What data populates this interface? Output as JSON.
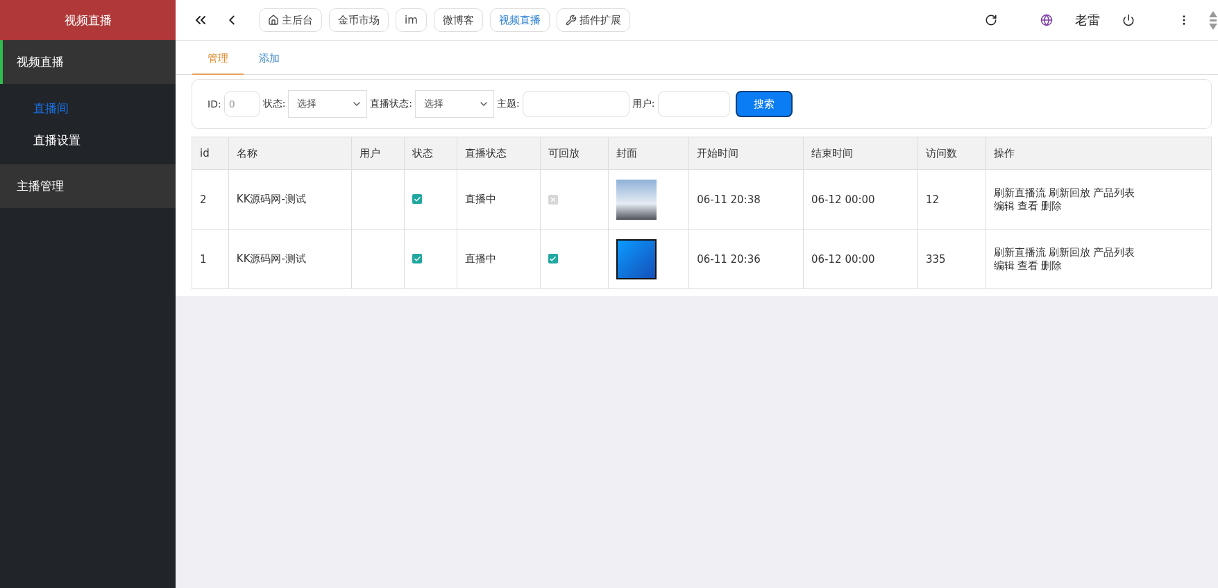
{
  "sidebar": {
    "brand": "视频直播",
    "groups": [
      {
        "label": "视频直播",
        "expanded": true,
        "children": [
          {
            "label": "直播间",
            "selected": true
          },
          {
            "label": "直播设置",
            "selected": false
          }
        ]
      },
      {
        "label": "主播管理",
        "expanded": false
      }
    ]
  },
  "topbar": {
    "nav_tabs": [
      {
        "label": "主后台",
        "kind": "home",
        "selected": false
      },
      {
        "label": "金币市场",
        "kind": "plain",
        "selected": false
      },
      {
        "label": "im",
        "kind": "plain",
        "selected": false
      },
      {
        "label": "微博客",
        "kind": "plain",
        "selected": false
      },
      {
        "label": "视频直播",
        "kind": "plain",
        "selected": true
      },
      {
        "label": "插件扩展",
        "kind": "plugin",
        "selected": false
      }
    ],
    "user": "老雷"
  },
  "page_tabs": [
    {
      "label": "管理",
      "selected": true
    },
    {
      "label": "添加",
      "selected": false
    }
  ],
  "filters": [
    {
      "kind": "input",
      "label": "ID:",
      "placeholder": "0"
    },
    {
      "kind": "select",
      "label": "状态:",
      "value": "选择"
    },
    {
      "kind": "select",
      "label": "直播状态:",
      "value": "选择"
    },
    {
      "kind": "input",
      "label": "主题:"
    },
    {
      "kind": "input",
      "label": "用户:"
    }
  ],
  "search_button": "搜索",
  "table": {
    "columns": [
      "id",
      "名称",
      "用户",
      "状态",
      "直播状态",
      "可回放",
      "封面",
      "开始时间",
      "结束时间",
      "访问数",
      "操作"
    ],
    "rows": [
      {
        "id": "2",
        "name": "KK源码网-测试",
        "status": true,
        "live_status": "直播中",
        "replayable": false,
        "cover": {
          "kind": "photo"
        },
        "start": "06-11 20:38",
        "end": "06-12 00:00",
        "visits": "12",
        "actions": [
          [
            "刷新直播流",
            "刷新回放",
            "产品列表"
          ],
          [
            "编辑",
            "查看",
            "删除"
          ]
        ]
      },
      {
        "id": "1",
        "name": "KK源码网-测试",
        "status": true,
        "live_status": "直播中",
        "replayable": true,
        "cover": {
          "kind": "logo"
        },
        "start": "06-11 20:36",
        "end": "06-12 00:00",
        "visits": "335",
        "actions": [
          [
            "刷新直播流",
            "刷新回放",
            "产品列表"
          ],
          [
            "编辑",
            "查看",
            "删除"
          ]
        ]
      }
    ]
  }
}
